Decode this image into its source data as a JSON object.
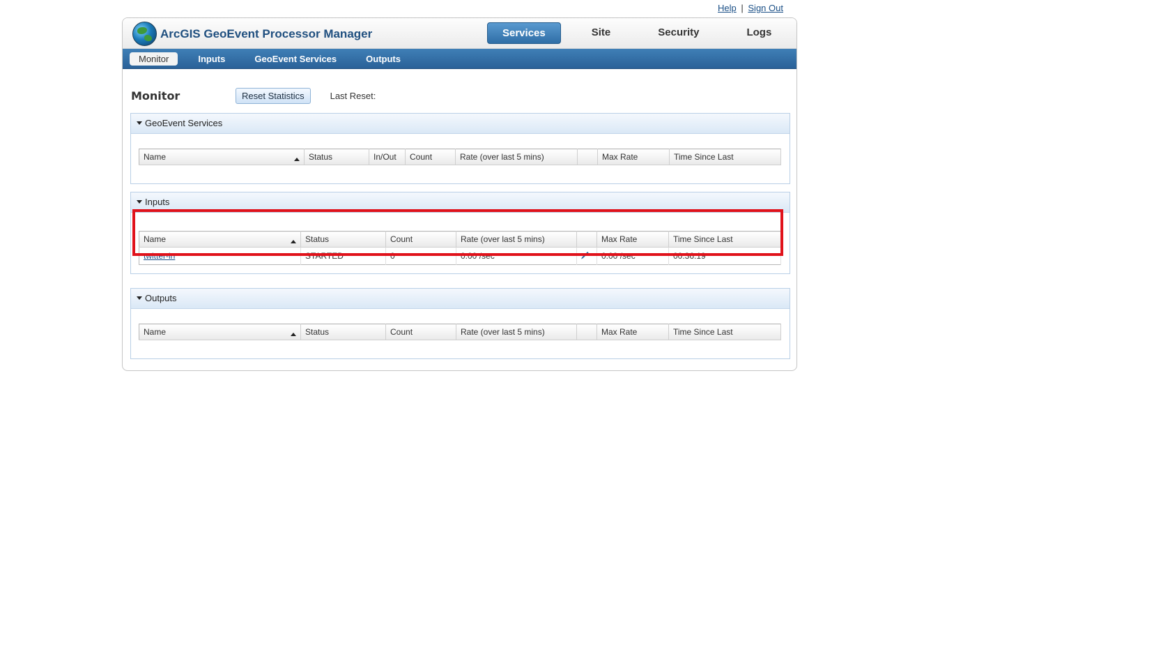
{
  "top_links": {
    "help": "Help",
    "separator": "|",
    "sign_out": "Sign Out"
  },
  "header": {
    "app_title": "ArcGIS GeoEvent Processor Manager",
    "nav": [
      {
        "label": "Services",
        "active": true
      },
      {
        "label": "Site",
        "active": false
      },
      {
        "label": "Security",
        "active": false
      },
      {
        "label": "Logs",
        "active": false
      }
    ]
  },
  "subnav": [
    {
      "label": "Monitor",
      "active": true
    },
    {
      "label": "Inputs",
      "active": false
    },
    {
      "label": "GeoEvent Services",
      "active": false
    },
    {
      "label": "Outputs",
      "active": false
    }
  ],
  "monitor": {
    "title": "Monitor",
    "reset_button": "Reset Statistics",
    "last_reset_label": "Last Reset:"
  },
  "panels": {
    "geoevent_services": {
      "title": "GeoEvent Services",
      "columns": [
        "Name",
        "Status",
        "In/Out",
        "Count",
        "Rate (over last 5 mins)",
        "",
        "Max Rate",
        "Time Since Last"
      ]
    },
    "inputs": {
      "title": "Inputs",
      "columns": [
        "Name",
        "Status",
        "Count",
        "Rate (over last 5 mins)",
        "",
        "Max Rate",
        "Time Since Last"
      ],
      "rows": [
        {
          "name": "twitter-in",
          "status": "STARTED",
          "count": "0",
          "rate": "0.00 /sec",
          "max_rate": "0.00 /sec",
          "time_since_last": "00:36:19"
        }
      ]
    },
    "outputs": {
      "title": "Outputs",
      "columns": [
        "Name",
        "Status",
        "Count",
        "Rate (over last 5 mins)",
        "",
        "Max Rate",
        "Time Since Last"
      ]
    }
  },
  "colors": {
    "highlight": "#e0121b",
    "rate_green": "#1a8a1a",
    "accent": "#2f6ea6"
  }
}
